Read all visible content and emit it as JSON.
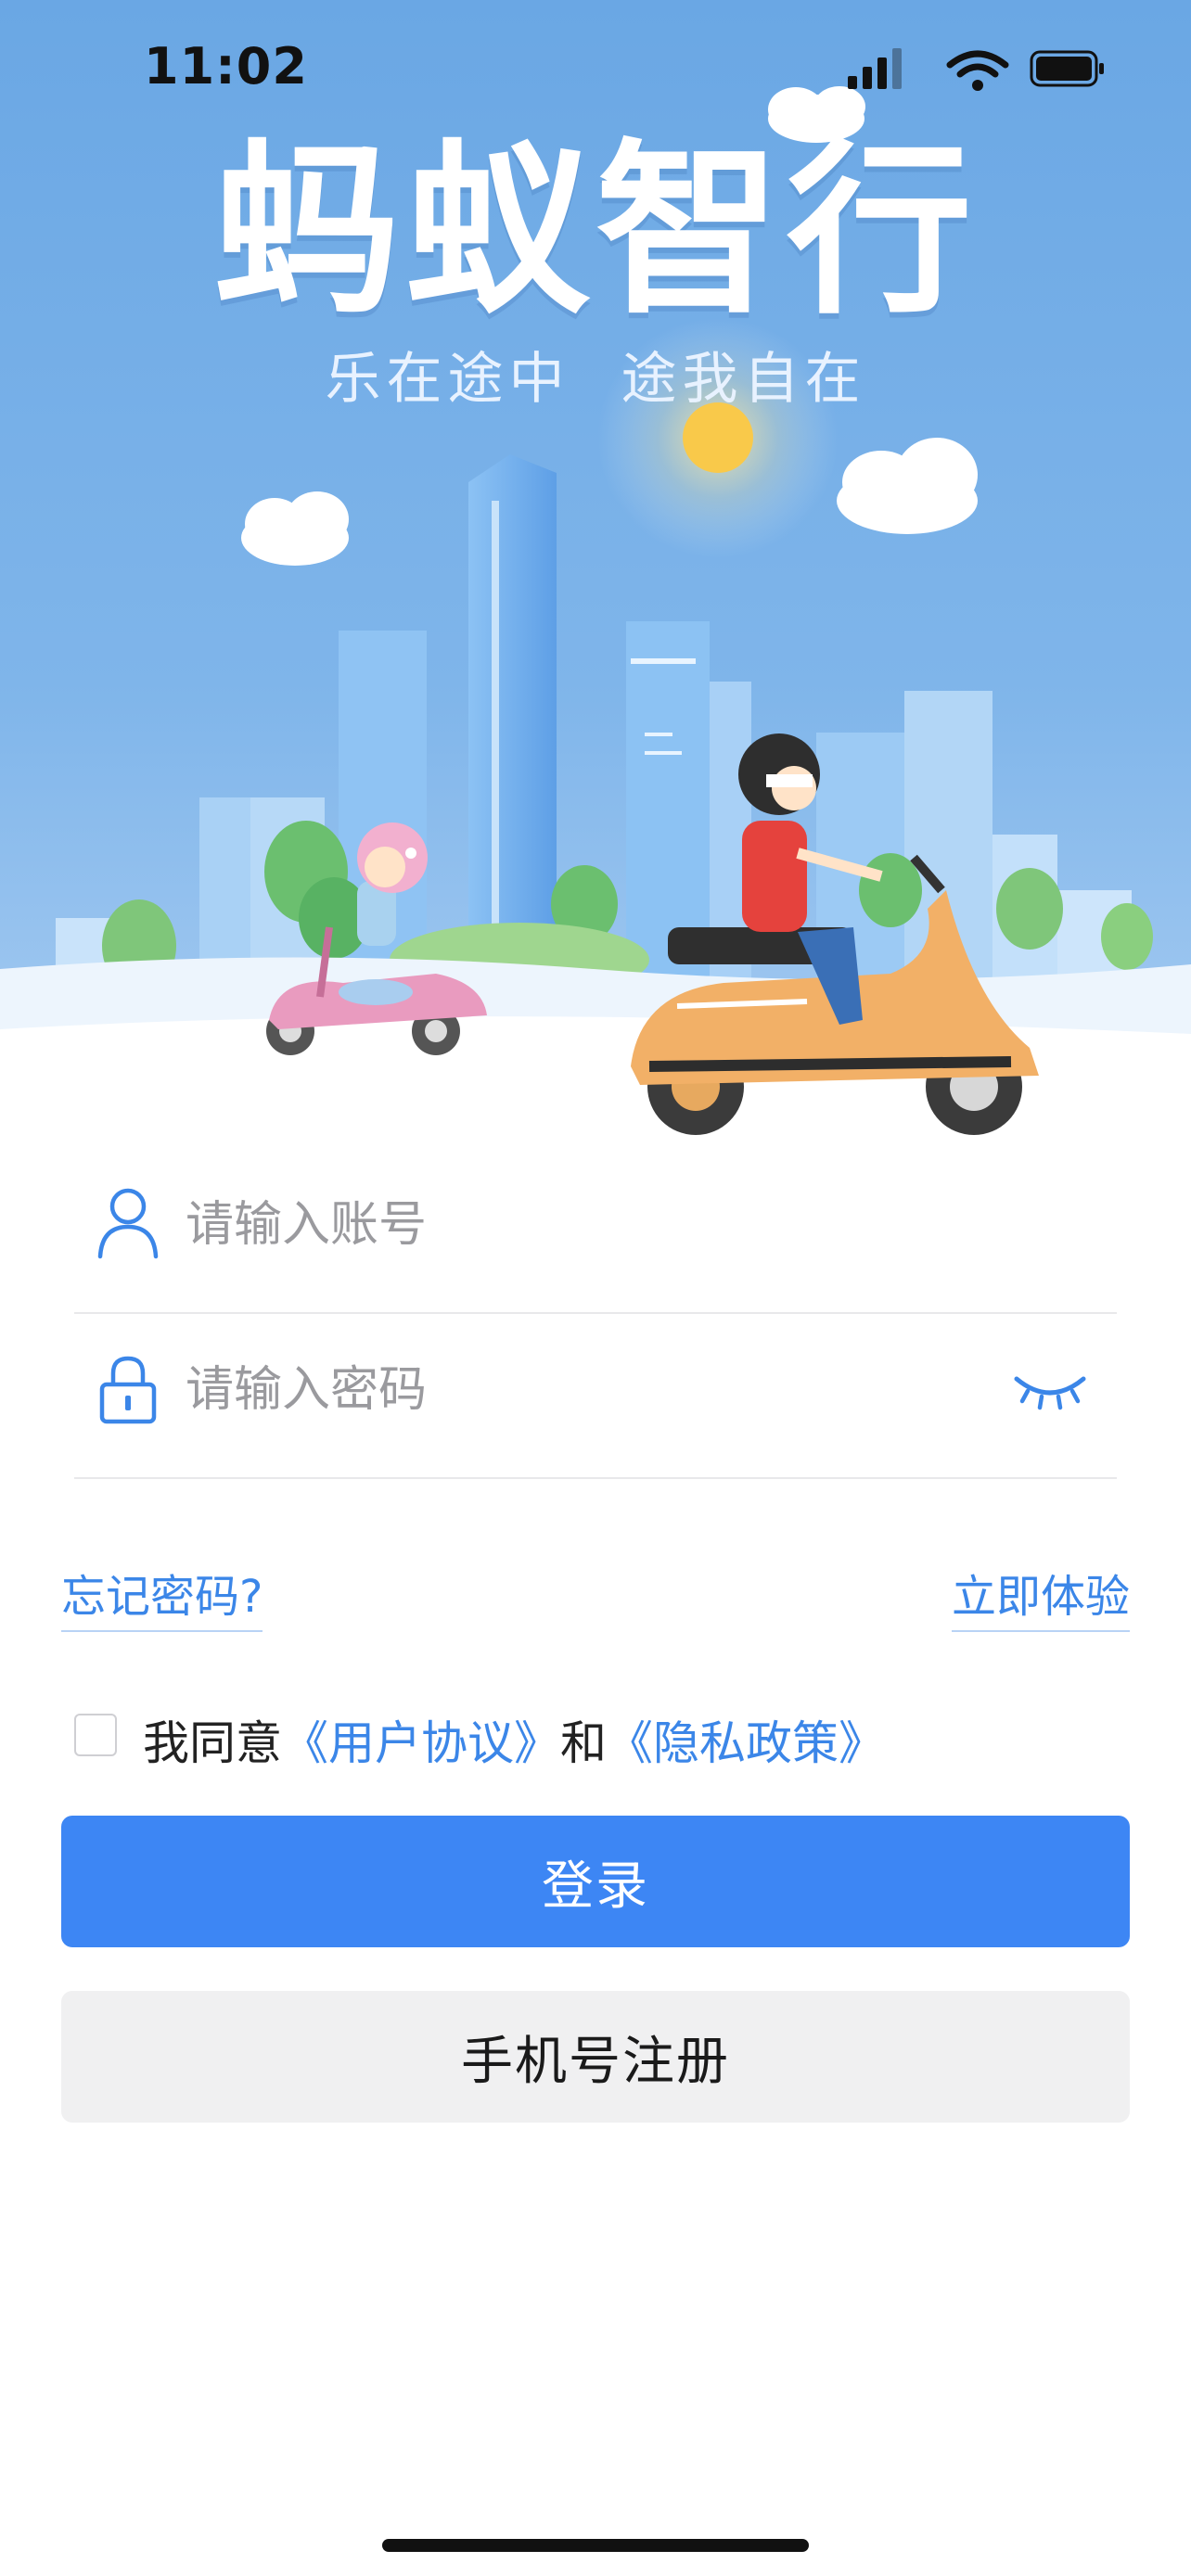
{
  "status_bar": {
    "time": "11:02"
  },
  "brand": {
    "title": "蚂蚁智行",
    "slogan": "乐在途中   途我自在"
  },
  "login_form": {
    "account_placeholder": "请输入账号",
    "password_placeholder": "请输入密码",
    "forgot_password": "忘记密码?",
    "try_now": "立即体验",
    "agree_prefix": "我同意",
    "user_agreement": "《用户协议》",
    "and_text": "和",
    "privacy_policy": "《隐私政策》",
    "agreement_checked": false
  },
  "buttons": {
    "login": "登录",
    "phone_register": "手机号注册"
  },
  "icons": {
    "account": "user-icon",
    "password": "lock-icon",
    "visibility": "eye-closed-icon"
  },
  "colors": {
    "accent": "#3d86f4",
    "link": "#3b86e8",
    "sky": "#6aa8e6"
  }
}
